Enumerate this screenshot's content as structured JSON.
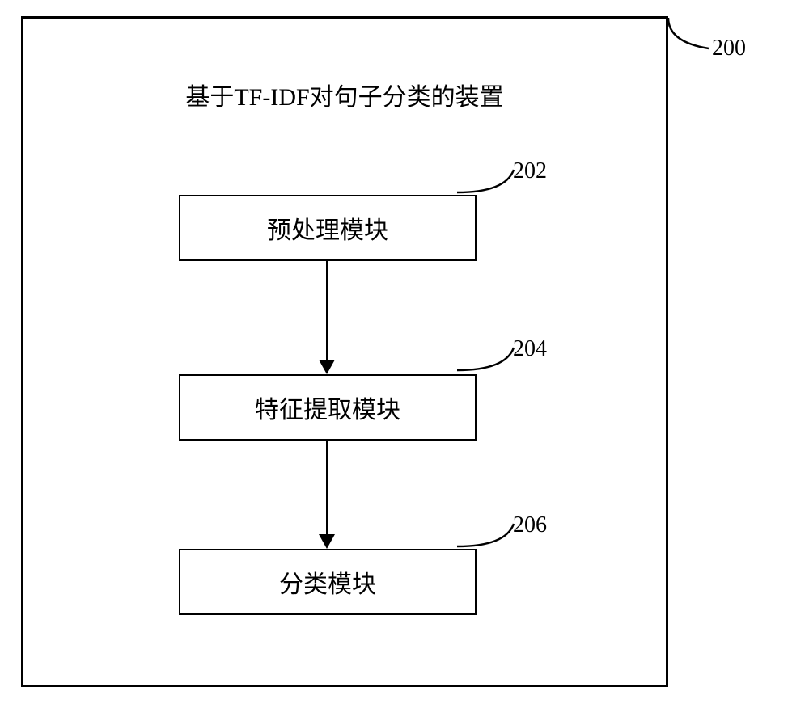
{
  "diagram": {
    "title": "基于TF-IDF对句子分类的装置",
    "container_ref": "200",
    "modules": [
      {
        "label": "预处理模块",
        "ref": "202"
      },
      {
        "label": "特征提取模块",
        "ref": "204"
      },
      {
        "label": "分类模块",
        "ref": "206"
      }
    ]
  }
}
